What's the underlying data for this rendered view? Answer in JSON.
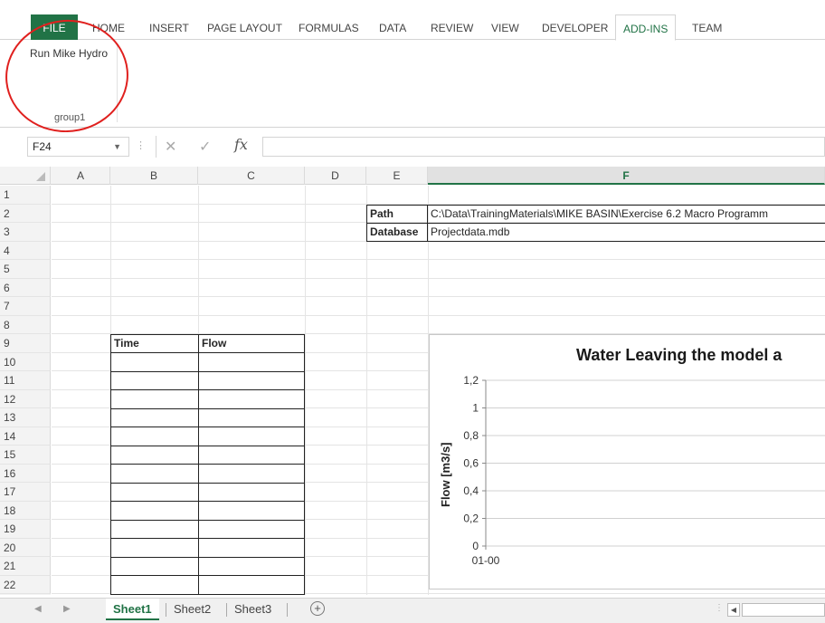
{
  "ribbon": {
    "tabs": [
      "FILE",
      "HOME",
      "INSERT",
      "PAGE LAYOUT",
      "FORMULAS",
      "DATA",
      "REVIEW",
      "VIEW",
      "DEVELOPER",
      "ADD-INS",
      "TEAM"
    ],
    "active_tab": "ADD-INS",
    "run_button": "Run Mike Hydro",
    "group_label": "group1",
    "annotation_color": "#e0201e"
  },
  "formula_bar": {
    "name_box": "F24",
    "fx": "fx",
    "formula": ""
  },
  "grid": {
    "columns": [
      "A",
      "B",
      "C",
      "D",
      "E",
      "F"
    ],
    "selected_column": "F",
    "rows": [
      "1",
      "2",
      "3",
      "4",
      "5",
      "6",
      "7",
      "8",
      "9",
      "10",
      "11",
      "12",
      "13",
      "14",
      "15",
      "16",
      "17",
      "18",
      "19",
      "20",
      "21",
      "22"
    ]
  },
  "path_table": {
    "path_key": "Path",
    "path_value": "C:\\Data\\TrainingMaterials\\MIKE BASIN\\Exercise 6.2 Macro Programm",
    "db_key": "Database",
    "db_value": "Projectdata.mdb"
  },
  "flow_table": {
    "headers": [
      "Time",
      "Flow"
    ]
  },
  "chart_data": {
    "type": "line",
    "title": "Water Leaving the model a",
    "ylabel": "Flow [m3/s]",
    "xlabel": "",
    "y_ticks": [
      "1,2",
      "1",
      "0,8",
      "0,6",
      "0,4",
      "0,2",
      "0"
    ],
    "x_ticks": [
      "01-00"
    ],
    "ylim": [
      0,
      1.2
    ],
    "grid": true,
    "series": []
  },
  "sheets": {
    "tabs": [
      "Sheet1",
      "Sheet2",
      "Sheet3"
    ],
    "active": "Sheet1"
  },
  "colors": {
    "accent": "#217346"
  }
}
